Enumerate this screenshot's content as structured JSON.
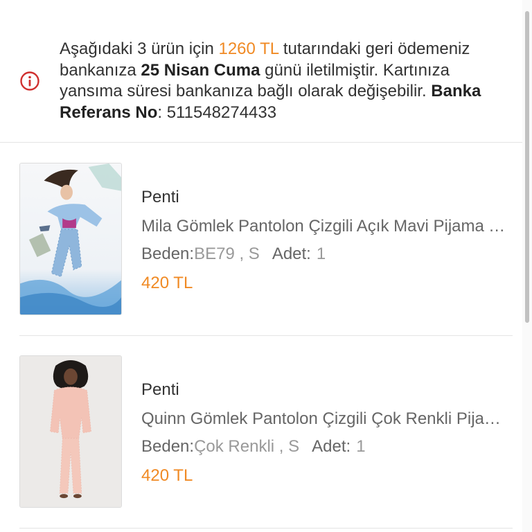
{
  "notice": {
    "icon": "info-circle-icon",
    "icon_color": "#d0302f",
    "text_before_amount": "Aşağıdaki 3 ürün için ",
    "amount": "1260 TL",
    "text_after_amount": " tutarındaki geri ödemeniz bankanıza ",
    "date": "25 Nisan Cuma",
    "text_after_date": " günü iletilmiştir. Kartınıza yansıma süresi bankanıza bağlı olarak değişebilir. ",
    "reference_label": "Banka Referans No",
    "reference_value": ": 511548274433"
  },
  "labels": {
    "size": "Beden:",
    "quantity": "Adet:"
  },
  "products": [
    {
      "brand": "Penti",
      "name": "Mila Gömlek Pantolon Çizgili Açık Mavi Pijama Takımı",
      "size": "BE79 , S",
      "quantity": "1",
      "price": "420 TL"
    },
    {
      "brand": "Penti",
      "name": "Quinn Gömlek Pantolon Çizgili Çok Renkli Pijama Takımı",
      "size": "Çok Renkli , S",
      "quantity": "1",
      "price": "420 TL"
    }
  ],
  "colors": {
    "accent_price": "#f08a24",
    "divider": "#e4e4e4"
  }
}
